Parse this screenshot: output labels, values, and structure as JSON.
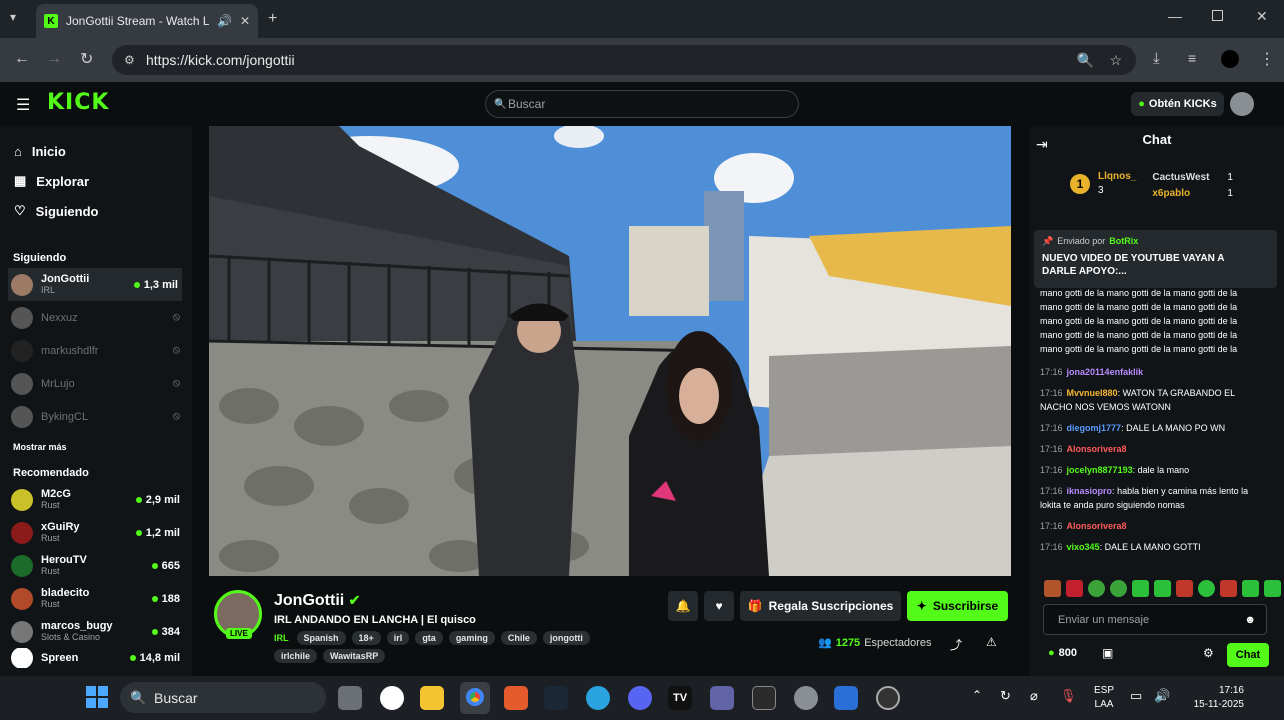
{
  "browser": {
    "tab_title": "JonGottii Stream - Watch Li",
    "url": "https://kick.com/jongottii"
  },
  "header": {
    "logo": "KICK",
    "search_placeholder": "Buscar",
    "get_kicks_label": "Obtén KICKs"
  },
  "sidebar": {
    "nav": [
      {
        "label": "Inicio",
        "icon": "home-icon"
      },
      {
        "label": "Explorar",
        "icon": "compass-icon"
      },
      {
        "label": "Siguiendo",
        "icon": "heart-icon"
      }
    ],
    "following_title": "Siguiendo",
    "following": [
      {
        "name": "JonGottii",
        "category": "IRL",
        "viewers": "1,3 mil",
        "live": true
      },
      {
        "name": "Nexxuz",
        "live": false
      },
      {
        "name": "markushdlfr",
        "live": false
      },
      {
        "name": "MrLujo",
        "live": false
      },
      {
        "name": "BykingCL",
        "live": false
      }
    ],
    "show_more": "Mostrar más",
    "recommended_title": "Recomendado",
    "recommended": [
      {
        "name": "M2cG",
        "category": "Rust",
        "viewers": "2,9 mil"
      },
      {
        "name": "xGuiRy",
        "category": "Rust",
        "viewers": "1,2 mil"
      },
      {
        "name": "HerouTV",
        "category": "Rust",
        "viewers": "665"
      },
      {
        "name": "bladecito",
        "category": "Rust",
        "viewers": "188"
      },
      {
        "name": "marcos_bugy",
        "category": "Slots & Casino",
        "viewers": "384"
      },
      {
        "name": "Spreen",
        "category": "",
        "viewers": "14,8 mil"
      }
    ]
  },
  "stream": {
    "name": "JonGottii",
    "live_badge": "LIVE",
    "title": "IRL ANDANDO EN LANCHA | El quisco",
    "category": "IRL",
    "tags": [
      "Spanish",
      "18+",
      "irl",
      "gta",
      "gaming",
      "Chile",
      "jongotti",
      "irlchile",
      "WawitasRP"
    ],
    "gift_label": "Regala Suscripciones",
    "subscribe_label": "Suscribirse",
    "viewers_count": "1275",
    "viewers_label": "Espectadores"
  },
  "chat": {
    "title": "Chat",
    "leaderboard": {
      "first": {
        "name": "Llqnos_",
        "count": "3"
      },
      "second": {
        "name": "CactusWest",
        "count": "1"
      },
      "third": {
        "name": "x6pablo",
        "count": "1"
      }
    },
    "pinned_by_label": "Enviado por",
    "pinned_by": "BotRix",
    "pinned_text": "NUEVO VIDEO DE YOUTUBE VAYAN A DARLE APOYO:...",
    "spam_text": "mano gotti de la mano gotti de la mano gotti de la mano gotti de la mano gotti de la mano gotti de la mano gotti de la mano gotti de la mano gotti de la mano gotti de la mano gotti de la mano gotti de la mano gotti de la mano gotti de la mano gotti de la mano gotti",
    "messages": [
      {
        "time": "17:16",
        "user": "jona20114enfaklik",
        "text": "",
        "color": "#b78cff"
      },
      {
        "time": "17:16",
        "user": "Mvvnuel880",
        "text": "WATON TA GRABANDO EL NACHO NOS VEMOS WATONN",
        "color": "#f7b733"
      },
      {
        "time": "17:16",
        "user": "diegomj1777",
        "text": "DALE LA MANO PO WN",
        "color": "#5b9bff"
      },
      {
        "time": "17:16",
        "user": "Alonsorivera8",
        "text": "",
        "color": "#ff5b5b"
      },
      {
        "time": "17:16",
        "user": "jocelyn8877193",
        "text": "dale la mano",
        "color": "#53fc18"
      },
      {
        "time": "17:16",
        "user": "iknasiopro",
        "text": "habla bien y camina más lento la lokita te anda puro siguiendo nomas",
        "color": "#b78cff"
      },
      {
        "time": "17:16",
        "user": "Alonsorivera8",
        "text": "",
        "color": "#ff5b5b"
      },
      {
        "time": "17:16",
        "user": "vixo345",
        "text": "DALE LA MANO GOTTI",
        "color": "#53fc18"
      }
    ],
    "input_placeholder": "Enviar un mensaje",
    "kicks_balance": "800",
    "chat_button": "Chat"
  },
  "taskbar": {
    "search_placeholder": "Buscar",
    "lang": "ESP",
    "lang2": "LAA",
    "time": "17:16",
    "date": "15-11-2025"
  },
  "colors": {
    "accent": "#53fc18",
    "bg": "#0b0e0f",
    "panel": "#111417"
  }
}
